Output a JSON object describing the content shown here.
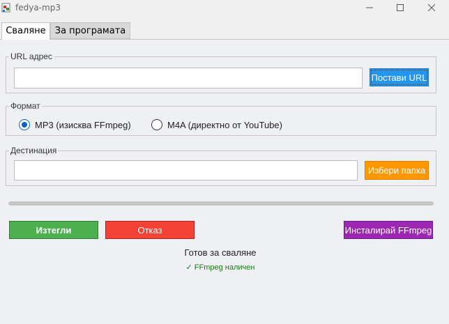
{
  "window": {
    "title": "fedya-mp3",
    "icon": "app-icon",
    "controls": [
      "minimize-icon",
      "maximize-icon",
      "close-icon"
    ]
  },
  "tabs": [
    {
      "label": "Сваляне",
      "active": true
    },
    {
      "label": "За програмата",
      "active": false
    }
  ],
  "url_group": {
    "legend": "URL адрес",
    "input_value": "",
    "paste_button": "Постави URL"
  },
  "format_group": {
    "legend": "Формат",
    "options": [
      {
        "label": "MP3 (изисква FFmpeg)",
        "selected": true
      },
      {
        "label": "M4A (директно от YouTube)",
        "selected": false
      }
    ]
  },
  "destination_group": {
    "legend": "Дестинация",
    "input_value": "",
    "browse_button": "Избери папка"
  },
  "progress": {
    "value": 0
  },
  "actions": {
    "download": "Изтегли",
    "cancel": "Отказ",
    "install_ffmpeg": "Инсталирай FFmpeg"
  },
  "status": {
    "text": "Готов за сваляне",
    "ffmpeg": "✓ FFmpeg наличен"
  },
  "colors": {
    "paste": "#2196f3",
    "browse": "#ff9800",
    "download": "#4caf50",
    "cancel": "#f44336",
    "install": "#9c27b0",
    "ffmpeg_ok": "#1b7a1b"
  }
}
